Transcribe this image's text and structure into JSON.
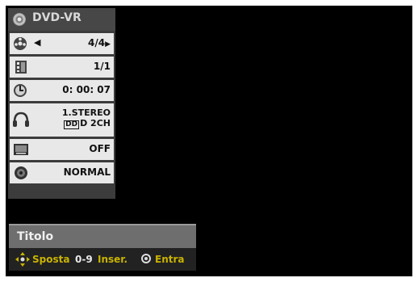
{
  "panel": {
    "header": "DVD-VR",
    "title_value": "4/4",
    "chapter_value": "1/1",
    "time_value": "0: 00: 07",
    "audio_line1": "1.STEREO",
    "audio_line2": "D 2CH",
    "subtitle_value": "OFF",
    "sound_value": "NORMAL"
  },
  "info_bar": {
    "label": "Titolo"
  },
  "help": {
    "move_label": "Sposta",
    "num_key": "0-9",
    "insert_label": "Inser.",
    "enter_label": "Entra"
  },
  "colors": {
    "accent": "#c9b300",
    "panel": "#3c3c3c",
    "row": "#e8e8e8"
  }
}
